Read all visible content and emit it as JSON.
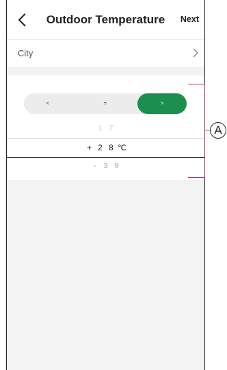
{
  "header": {
    "title": "Outdoor Temperature",
    "next_label": "Next"
  },
  "city": {
    "label": "City"
  },
  "comparison": {
    "options": [
      "<",
      "=",
      ">"
    ],
    "selected": ">",
    "accent_color": "#1e8e4e"
  },
  "picker": {
    "above": [
      "1",
      "7"
    ],
    "selected": [
      "+",
      "2",
      "8",
      "℃"
    ],
    "below": [
      "-",
      "3",
      "9"
    ]
  },
  "callout": {
    "label": "A"
  }
}
